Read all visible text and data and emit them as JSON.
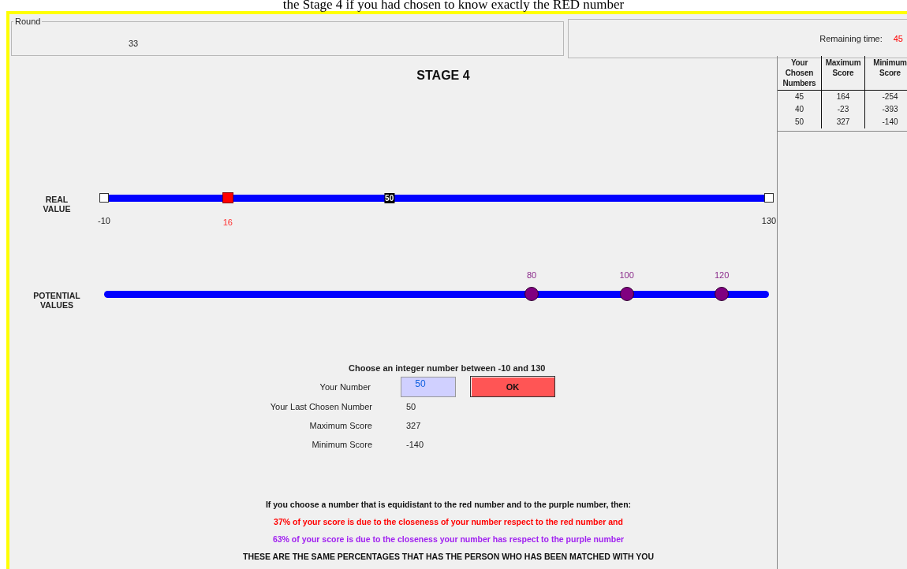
{
  "caption": "the Stage 4 if you had chosen to know exactly the RED number",
  "round_panel": {
    "legend": "Round",
    "value": "33"
  },
  "time_panel": {
    "label": "Remaining time:",
    "value": "45"
  },
  "stage_title": "STAGE 4",
  "real_value": {
    "label": "REAL VALUE",
    "min": "-10",
    "max": "130",
    "markers": [
      {
        "kind": "red",
        "level": 0.186,
        "label": "16"
      },
      {
        "kind": "black",
        "level": 0.429,
        "label": "50"
      }
    ]
  },
  "potential_values": {
    "label": "POTENTIAL VALUES",
    "markers": [
      {
        "level": 0.643,
        "label": "80"
      },
      {
        "level": 0.786,
        "label": "100"
      },
      {
        "level": 0.929,
        "label": "120"
      }
    ]
  },
  "form": {
    "prompt": "Choose an integer number between -10 and 130",
    "field_label": "Your Number",
    "field_value": "50",
    "ok_button": "OK",
    "rows": [
      {
        "label": "Your Last Chosen Number",
        "value": "50"
      },
      {
        "label": "Maximum Score",
        "value": "327"
      },
      {
        "label": "Minimum Score",
        "value": "-140"
      }
    ]
  },
  "notes": [
    {
      "kind": "plain",
      "text": "If you choose a number that is equidistant to the red number and to the purple number, then:"
    },
    {
      "kind": "red",
      "text": "37% of your score is due to the closeness of your number respect to the red number and"
    },
    {
      "kind": "purple",
      "text": "63% of your score is due to the closeness your number has respect to the purple number"
    },
    {
      "kind": "caps",
      "text": "THESE ARE THE SAME PERCENTAGES THAT HAS THE PERSON WHO HAS BEEN MATCHED WITH YOU"
    }
  ],
  "history_table": {
    "columns": [
      "Your Chosen Numbers",
      "Maximum Score",
      "Minimum Score"
    ],
    "rows": [
      [
        "45",
        "164",
        "-254"
      ],
      [
        "40",
        "-23",
        "-393"
      ],
      [
        "50",
        "327",
        "-140"
      ]
    ]
  }
}
